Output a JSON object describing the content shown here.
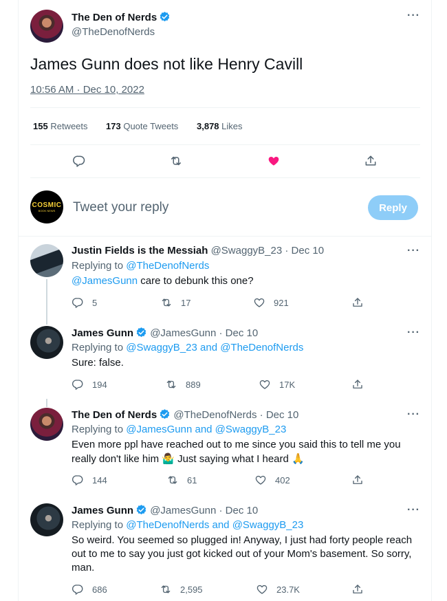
{
  "main_tweet": {
    "author_name": "The Den of Nerds",
    "author_handle": "@TheDenofNerds",
    "text": "James Gunn does not like Henry Cavill",
    "timestamp": "10:56 AM · Dec 10, 2022",
    "retweets_count": "155",
    "retweets_label": "Retweets",
    "quotes_count": "173",
    "quotes_label": "Quote Tweets",
    "likes_count": "3,878",
    "likes_label": "Likes"
  },
  "composer": {
    "avatar_text": "COSMIC",
    "avatar_subtext": "BOOK NEWS",
    "placeholder": "Tweet your reply",
    "reply_button": "Reply"
  },
  "replies": [
    {
      "author_name": "Justin Fields is the Messiah",
      "author_handle": "@SwaggyB_23",
      "date": "· Dec 10",
      "replying_prefix": "Replying to",
      "replying_to": "@TheDenofNerds",
      "mention": "@JamesGunn",
      "text": "care to debunk this one?",
      "replies": "5",
      "retweets": "17",
      "likes": "921"
    },
    {
      "author_name": "James Gunn",
      "author_handle": "@JamesGunn",
      "date": "· Dec 10",
      "replying_prefix": "Replying to",
      "replying_to": "@SwaggyB_23 and @TheDenofNerds",
      "text": "Sure: false.",
      "replies": "194",
      "retweets": "889",
      "likes": "17K"
    },
    {
      "author_name": "The Den of Nerds",
      "author_handle": "@TheDenofNerds",
      "date": "· Dec 10",
      "replying_prefix": "Replying to",
      "replying_to": "@JamesGunn and @SwaggyB_23",
      "text_line1": "Even more ppl have reached out to me since you said this to tell me you",
      "text_line2": "really don't like him 🤷‍♂️ Just saying what I heard 🙏",
      "replies": "144",
      "retweets": "61",
      "likes": "402"
    },
    {
      "author_name": "James Gunn",
      "author_handle": "@JamesGunn",
      "date": "· Dec 10",
      "replying_prefix": "Replying to",
      "replying_to": "@TheDenofNerds and @SwaggyB_23",
      "text_line1": "So weird. You seemed so plugged in! Anyway, I just had forty people reach",
      "text_line2": "out to me to say you just got kicked out of your Mom's basement. So sorry,",
      "text_line3": "man.",
      "replies": "686",
      "retweets": "2,595",
      "likes": "23.7K"
    }
  ],
  "colors": {
    "accent": "#1d9bf0",
    "like_active": "#f91880",
    "muted": "#536471",
    "reply_button_disabled": "#8ecdf8"
  },
  "icons": {
    "more": "more-icon",
    "verified": "verified-badge-icon",
    "reply": "reply-icon",
    "retweet": "retweet-icon",
    "like": "heart-icon",
    "share": "share-icon"
  }
}
